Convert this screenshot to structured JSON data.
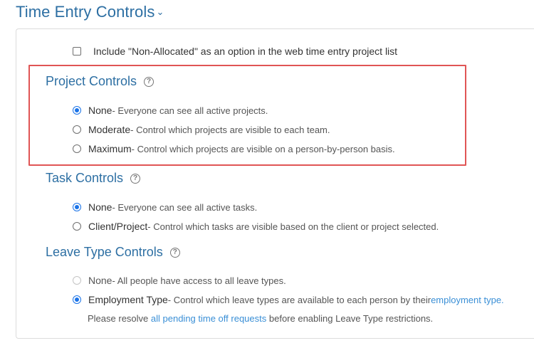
{
  "header": {
    "title": "Time Entry Controls",
    "chevron": "⌄"
  },
  "non_allocated": {
    "label": "Include \"Non-Allocated\" as an option in the web time entry project list",
    "checked": false
  },
  "project_controls": {
    "title": "Project Controls",
    "options": [
      {
        "name": "None",
        "desc": " - Everyone can see all active projects.",
        "checked": true
      },
      {
        "name": "Moderate",
        "desc": " - Control which projects are visible to each team.",
        "checked": false
      },
      {
        "name": "Maximum",
        "desc": " - Control which projects are visible on a person-by-person basis.",
        "checked": false
      }
    ]
  },
  "task_controls": {
    "title": "Task Controls",
    "options": [
      {
        "name": "None",
        "desc": " - Everyone can see all active tasks.",
        "checked": true
      },
      {
        "name": "Client/Project",
        "desc": " - Control which tasks are visible based on the client or project selected.",
        "checked": false
      }
    ]
  },
  "leave_controls": {
    "title": "Leave Type Controls",
    "options": [
      {
        "name": "None",
        "desc": " - All people have access to all leave types.",
        "checked": false,
        "disabled": true
      },
      {
        "name": "Employment Type",
        "desc": " - Control which leave types are available to each person by their ",
        "link": "employment type.",
        "checked": true
      }
    ],
    "note_prefix": "Please resolve ",
    "note_link": "all pending time off requests",
    "note_suffix": " before enabling Leave Type restrictions."
  },
  "colors": {
    "accent": "#2d6fa3",
    "link": "#3a8fd6",
    "highlight": "#e05555",
    "radio_checked": "#1a73e8"
  },
  "icons": {
    "help": "question-circle-icon"
  }
}
